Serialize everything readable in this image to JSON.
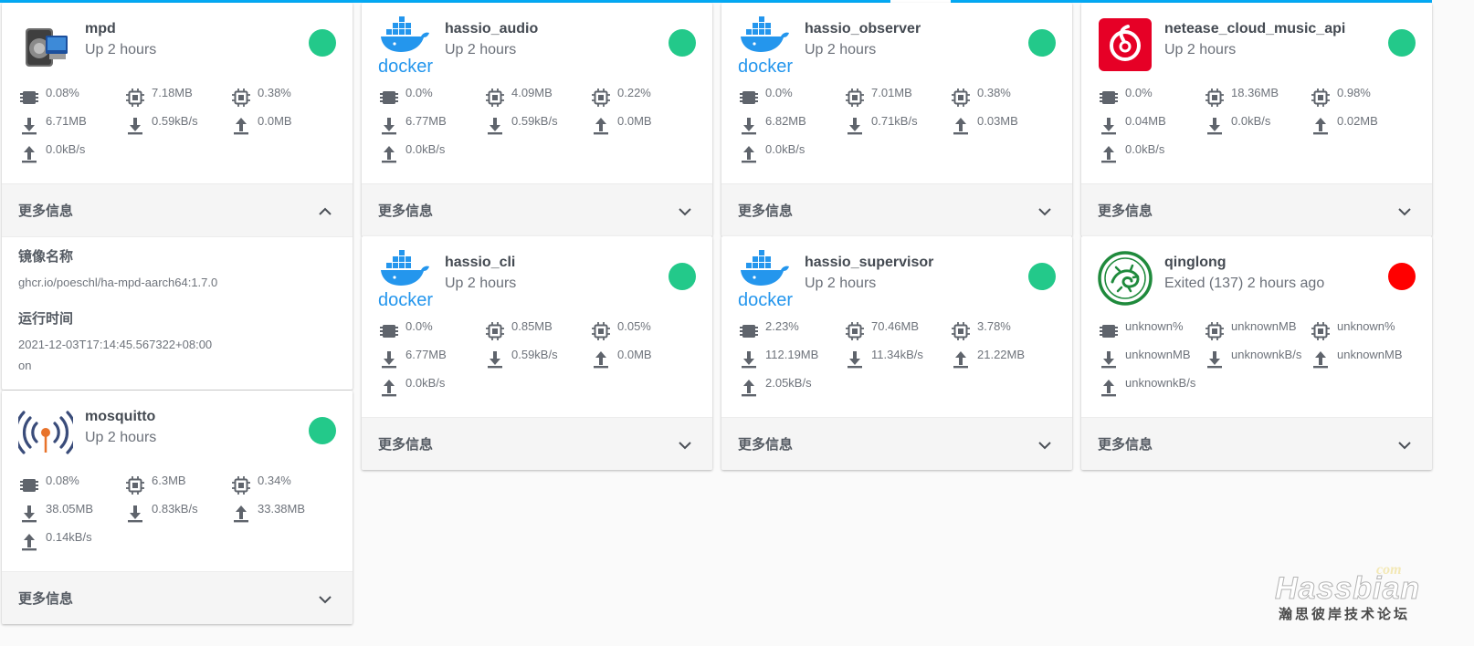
{
  "colors": {
    "running": "#23c98a",
    "exited": "#ff0000",
    "accent": "#03a9f4"
  },
  "more_label": "更多信息",
  "containers": [
    {
      "id": "mpd",
      "name": "mpd",
      "status": "Up 2 hours",
      "state": "running",
      "icon": "speaker-icon",
      "cpu": "0.08%",
      "memory": "7.18MB",
      "memory_percent": "0.38%",
      "block_read": "6.71MB",
      "net_rx": "0.59kB/s",
      "block_write": "0.0MB",
      "net_tx": "0.0kB/s",
      "expanded": true,
      "details": {
        "image_label": "镜像名称",
        "image_value": "ghcr.io/poeschl/ha-mpd-aarch64:1.7.0",
        "runtime_label": "运行时间",
        "runtime_value": "2021-12-03T17:14:45.567322+08:00",
        "extra": "on"
      }
    },
    {
      "id": "mosquitto",
      "name": "mosquitto",
      "status": "Up 2 hours",
      "state": "running",
      "icon": "broadcast-icon",
      "cpu": "0.08%",
      "memory": "6.3MB",
      "memory_percent": "0.34%",
      "block_read": "38.05MB",
      "net_rx": "0.83kB/s",
      "block_write": "33.38MB",
      "net_tx": "0.14kB/s"
    },
    {
      "id": "hassio_audio",
      "name": "hassio_audio",
      "status": "Up 2 hours",
      "state": "running",
      "icon": "docker-icon",
      "cpu": "0.0%",
      "memory": "4.09MB",
      "memory_percent": "0.22%",
      "block_read": "6.77MB",
      "net_rx": "0.59kB/s",
      "block_write": "0.0MB",
      "net_tx": "0.0kB/s"
    },
    {
      "id": "hassio_cli",
      "name": "hassio_cli",
      "status": "Up 2 hours",
      "state": "running",
      "icon": "docker-icon",
      "cpu": "0.0%",
      "memory": "0.85MB",
      "memory_percent": "0.05%",
      "block_read": "6.77MB",
      "net_rx": "0.59kB/s",
      "block_write": "0.0MB",
      "net_tx": "0.0kB/s"
    },
    {
      "id": "hassio_observer",
      "name": "hassio_observer",
      "status": "Up 2 hours",
      "state": "running",
      "icon": "docker-icon",
      "cpu": "0.0%",
      "memory": "7.01MB",
      "memory_percent": "0.38%",
      "block_read": "6.82MB",
      "net_rx": "0.71kB/s",
      "block_write": "0.03MB",
      "net_tx": "0.0kB/s"
    },
    {
      "id": "hassio_supervisor",
      "name": "hassio_supervisor",
      "status": "Up 2 hours",
      "state": "running",
      "icon": "docker-icon",
      "cpu": "2.23%",
      "memory": "70.46MB",
      "memory_percent": "3.78%",
      "block_read": "112.19MB",
      "net_rx": "11.34kB/s",
      "block_write": "21.22MB",
      "net_tx": "2.05kB/s"
    },
    {
      "id": "netease_cloud_music_api",
      "name": "netease_cloud_music_api",
      "status": "Up 2 hours",
      "state": "running",
      "icon": "netease-music-icon",
      "cpu": "0.0%",
      "memory": "18.36MB",
      "memory_percent": "0.98%",
      "block_read": "0.04MB",
      "net_rx": "0.0kB/s",
      "block_write": "0.02MB",
      "net_tx": "0.0kB/s"
    },
    {
      "id": "qinglong",
      "name": "qinglong",
      "status": "Exited (137) 2 hours ago",
      "state": "exited",
      "icon": "qinglong-dragon-icon",
      "cpu": "unknown%",
      "memory": "unknownMB",
      "memory_percent": "unknown%",
      "block_read": "unknownMB",
      "net_rx": "unknownkB/s",
      "block_write": "unknownMB",
      "net_tx": "unknownkB/s"
    }
  ],
  "watermark": {
    "com": "com",
    "brand": "Hassbian",
    "subtitle": "瀚思彼岸技术论坛"
  }
}
